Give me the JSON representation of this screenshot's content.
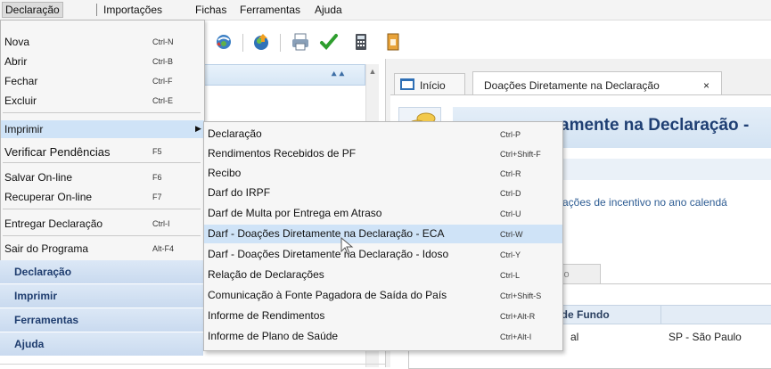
{
  "menubar": {
    "items": [
      {
        "label": "Declaração"
      },
      {
        "label": "Importações"
      },
      {
        "label": "Fichas"
      },
      {
        "label": "Ferramentas"
      },
      {
        "label": "Ajuda"
      }
    ]
  },
  "toolbar": {
    "icons": [
      "globe-arrows-icon",
      "globe-upload-icon",
      "printer-icon",
      "checkmark-icon",
      "calculator-icon",
      "document-icon"
    ]
  },
  "declaracao_menu": {
    "items": [
      {
        "label": "Nova",
        "shortcut": "Ctrl-N"
      },
      {
        "label": "Abrir",
        "shortcut": "Ctrl-B"
      },
      {
        "label": "Fechar",
        "shortcut": "Ctrl-F"
      },
      {
        "label": "Excluir",
        "shortcut": "Ctrl-E"
      },
      {
        "label": "Imprimir",
        "shortcut": ""
      },
      {
        "label": "Verificar Pendências",
        "shortcut": "F5"
      },
      {
        "label": "Salvar On-line",
        "shortcut": "F6"
      },
      {
        "label": "Recuperar On-line",
        "shortcut": "F7"
      },
      {
        "label": "Entregar Declaração",
        "shortcut": "Ctrl-I"
      },
      {
        "label": "Sair do Programa",
        "shortcut": "Alt-F4"
      }
    ]
  },
  "accordion": {
    "items": [
      {
        "label": "Declaração"
      },
      {
        "label": "Imprimir"
      },
      {
        "label": "Ferramentas"
      },
      {
        "label": "Ajuda"
      }
    ]
  },
  "imprimir_submenu": {
    "items": [
      {
        "label": "Declaração",
        "shortcut": "Ctrl-P"
      },
      {
        "label": "Rendimentos Recebidos de PF",
        "shortcut": "Ctrl+Shift-F"
      },
      {
        "label": "Recibo",
        "shortcut": "Ctrl-R"
      },
      {
        "label": "Darf do IRPF",
        "shortcut": "Ctrl-D"
      },
      {
        "label": "Darf de Multa por Entrega em Atraso",
        "shortcut": "Ctrl-U"
      },
      {
        "label": "Darf - Doações Diretamente na Declaração - ECA",
        "shortcut": "Ctrl-W"
      },
      {
        "label": "Darf - Doações Diretamente na Declaração - Idoso",
        "shortcut": "Ctrl-Y"
      },
      {
        "label": "Relação de Declarações",
        "shortcut": "Ctrl-L"
      },
      {
        "label": "Comunicação à Fonte Pagadora de Saída do País",
        "shortcut": "Ctrl+Shift-S"
      },
      {
        "label": "Informe de Rendimentos",
        "shortcut": "Ctrl+Alt-R"
      },
      {
        "label": "Informe de Plano de Saúde",
        "shortcut": "Ctrl+Alt-I"
      }
    ]
  },
  "tabs": {
    "inicio": "Início",
    "doacoes": "Doações Diretamente na Declaração",
    "close": "×"
  },
  "content": {
    "page_title": "amente na Declaração -",
    "incentive_text": "ações de incentivo no ano calendá",
    "inner_tab": "so",
    "table_header_fundo": "o de Fundo",
    "cell_left": "al",
    "cell_uf": "SP - São Paulo"
  },
  "colors": {
    "highlight": "#cfe3f7",
    "accordion": "#c9daef",
    "title_text": "#1f3f73",
    "check_green": "#2e9e2e"
  }
}
